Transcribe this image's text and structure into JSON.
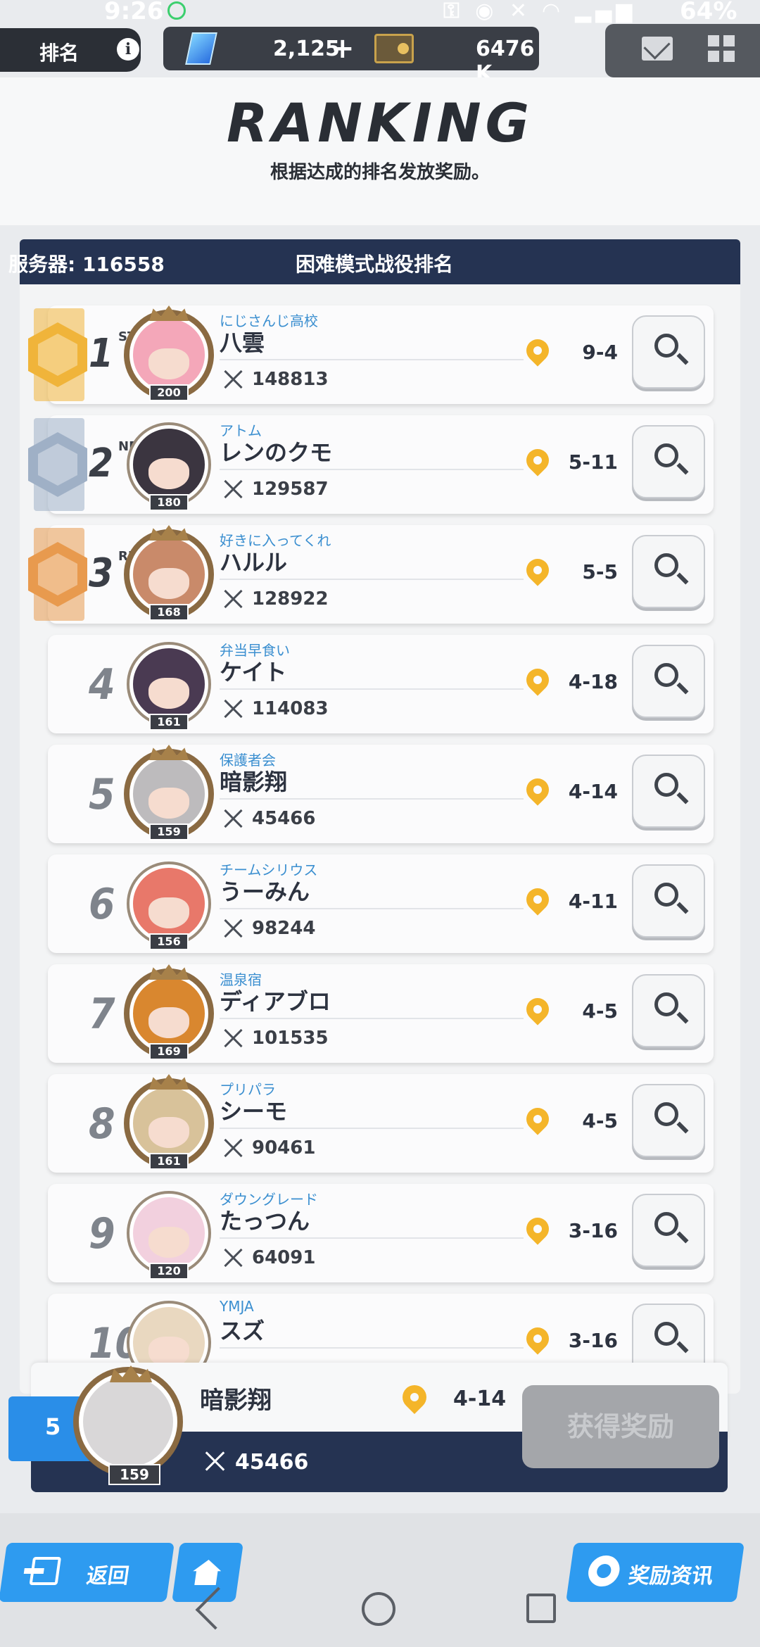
{
  "statusbar": {
    "time": "9:26",
    "battery": "64%",
    "network": "4G"
  },
  "hud": {
    "rank_tab": "排名",
    "info": "i",
    "crystals": "2,125",
    "plus": "+",
    "credits": "6476 K"
  },
  "header": {
    "title": "RANKING",
    "subtitle": "根据达成的排名发放奖励。"
  },
  "title_bar": {
    "server": "服务器: 116558",
    "title": "困难模式战役排名"
  },
  "medal_colors": {
    "gold": "#f0b43a",
    "silver": "#9fb0c6",
    "bronze": "#e89a4e"
  },
  "rows": [
    {
      "rank": "1",
      "sup": "ST",
      "level": "200",
      "guild": "にじさんじ高校",
      "name": "八雲",
      "power": "148813",
      "stage": "9-4"
    },
    {
      "rank": "2",
      "sup": "ND",
      "level": "180",
      "guild": "アトム",
      "name": "レンのクモ",
      "power": "129587",
      "stage": "5-11"
    },
    {
      "rank": "3",
      "sup": "RD",
      "level": "168",
      "guild": "好きに入ってくれ",
      "name": "ハルル",
      "power": "128922",
      "stage": "5-5"
    },
    {
      "rank": "4",
      "sup": "",
      "level": "161",
      "guild": "弁当早食い",
      "name": "ケイト",
      "power": "114083",
      "stage": "4-18"
    },
    {
      "rank": "5",
      "sup": "",
      "level": "159",
      "guild": "保護者会",
      "name": "暗影翔",
      "power": "45466",
      "stage": "4-14"
    },
    {
      "rank": "6",
      "sup": "",
      "level": "156",
      "guild": "チームシリウス",
      "name": "うーみん",
      "power": "98244",
      "stage": "4-11"
    },
    {
      "rank": "7",
      "sup": "",
      "level": "169",
      "guild": "温泉宿",
      "name": "ディアブロ",
      "power": "101535",
      "stage": "4-5"
    },
    {
      "rank": "8",
      "sup": "",
      "level": "161",
      "guild": "プリパラ",
      "name": "シーモ",
      "power": "90461",
      "stage": "4-5"
    },
    {
      "rank": "9",
      "sup": "",
      "level": "120",
      "guild": "ダウングレード",
      "name": "たっつん",
      "power": "64091",
      "stage": "3-16"
    },
    {
      "rank": "10",
      "sup": "",
      "level": "",
      "guild": "YMJA",
      "name": "スズ",
      "power": "",
      "stage": "3-16"
    }
  ],
  "my_rank": {
    "rank": "5",
    "level": "159",
    "name": "暗影翔",
    "stage": "4-14",
    "power": "45466",
    "claim": "获得奖励"
  },
  "footer": {
    "back": "返回",
    "reward_info": "奖励资讯"
  }
}
